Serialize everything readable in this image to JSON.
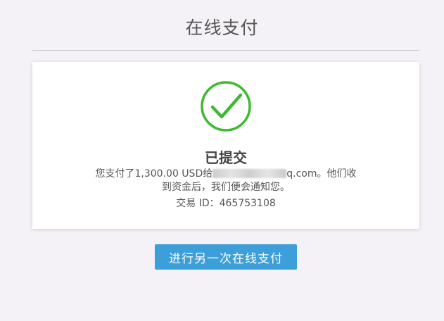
{
  "page": {
    "title": "在线支付"
  },
  "result": {
    "status": "已提交",
    "message_prefix": "您支付了1,300.00 USD给",
    "recipient_email_suffix": "q.com",
    "message_suffix": "。他们收到资金后，我们便会通知您。",
    "transaction_label": "交易 ID：",
    "transaction_id": "465753108"
  },
  "actions": {
    "repeat_payment_label": "进行另一次在线支付"
  },
  "colors": {
    "background": "#f4f2f6",
    "check": "#3dbb2e",
    "button": "#3d9fd9"
  },
  "icons": {
    "success": "check-circle-icon"
  }
}
